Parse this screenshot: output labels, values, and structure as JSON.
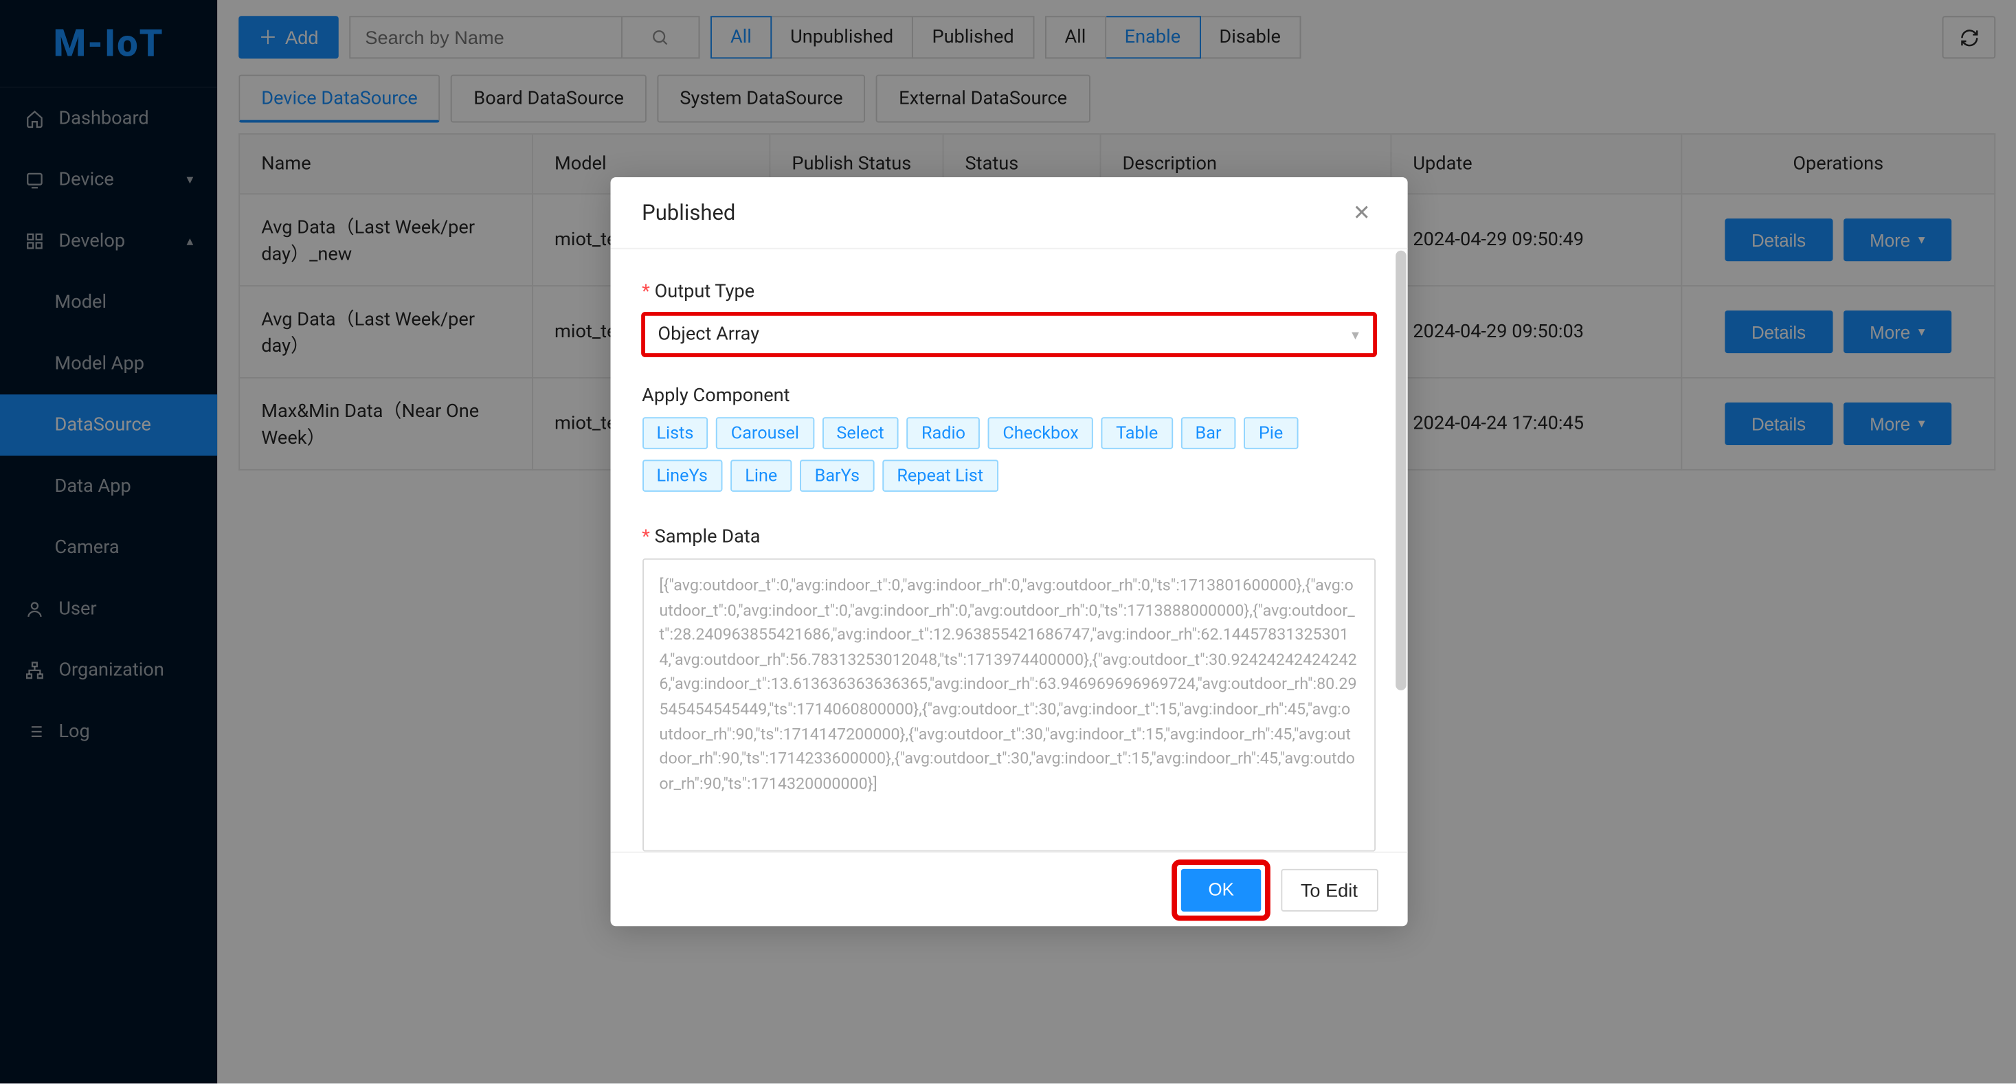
{
  "brand": "M-IoT",
  "sidebar": {
    "items": [
      {
        "icon": "home",
        "label": "Dashboard"
      },
      {
        "icon": "device",
        "label": "Device",
        "expandable": true
      },
      {
        "icon": "develop",
        "label": "Develop",
        "expandable": true,
        "open": true
      },
      {
        "icon": "",
        "label": "Model",
        "sub": true
      },
      {
        "icon": "",
        "label": "Model App",
        "sub": true
      },
      {
        "icon": "",
        "label": "DataSource",
        "sub": true,
        "active": true
      },
      {
        "icon": "",
        "label": "Data App",
        "sub": true
      },
      {
        "icon": "",
        "label": "Camera",
        "sub": true
      },
      {
        "icon": "user",
        "label": "User"
      },
      {
        "icon": "org",
        "label": "Organization"
      },
      {
        "icon": "log",
        "label": "Log"
      }
    ]
  },
  "toolbar": {
    "add_label": "Add",
    "search_placeholder": "Search by Name",
    "publish_filters": [
      "All",
      "Unpublished",
      "Published"
    ],
    "status_filters": [
      "All",
      "Enable",
      "Disable"
    ],
    "publish_active": 0,
    "status_active": 1
  },
  "tabs": [
    "Device DataSource",
    "Board DataSource",
    "System DataSource",
    "External DataSource"
  ],
  "tabs_active": 0,
  "table": {
    "columns": [
      "Name",
      "Model",
      "Publish Status",
      "Status",
      "Description",
      "Update",
      "Operations"
    ],
    "details_label": "Details",
    "more_label": "More",
    "rows": [
      {
        "name": "Avg Data（Last Week/per day）_new",
        "model": "miot_te",
        "update": "2024-04-29 09:50:49"
      },
      {
        "name": "Avg Data（Last Week/per day）",
        "model": "miot_te",
        "update": "2024-04-29 09:50:03"
      },
      {
        "name": "Max&Min Data（Near One Week）",
        "model": "miot_te",
        "update": "2024-04-24 17:40:45"
      }
    ]
  },
  "modal": {
    "title": "Published",
    "output_type_label": "Output Type",
    "output_type_value": "Object Array",
    "apply_component_label": "Apply Component",
    "components": [
      "Lists",
      "Carousel",
      "Select",
      "Radio",
      "Checkbox",
      "Table",
      "Bar",
      "Pie",
      "LineYs",
      "Line",
      "BarYs",
      "Repeat List"
    ],
    "sample_data_label": "Sample Data",
    "sample_data": "[{\"avg:outdoor_t\":0,\"avg:indoor_t\":0,\"avg:indoor_rh\":0,\"avg:outdoor_rh\":0,\"ts\":1713801600000},{\"avg:outdoor_t\":0,\"avg:indoor_t\":0,\"avg:indoor_rh\":0,\"avg:outdoor_rh\":0,\"ts\":1713888000000},{\"avg:outdoor_t\":28.240963855421686,\"avg:indoor_t\":12.963855421686747,\"avg:indoor_rh\":62.144578313253014,\"avg:outdoor_rh\":56.78313253012048,\"ts\":1713974400000},{\"avg:outdoor_t\":30.924242424242426,\"avg:indoor_t\":13.613636363636365,\"avg:indoor_rh\":63.946969696969724,\"avg:outdoor_rh\":80.29545454545449,\"ts\":1714060800000},{\"avg:outdoor_t\":30,\"avg:indoor_t\":15,\"avg:indoor_rh\":45,\"avg:outdoor_rh\":90,\"ts\":1714147200000},{\"avg:outdoor_t\":30,\"avg:indoor_t\":15,\"avg:indoor_rh\":45,\"avg:outdoor_rh\":90,\"ts\":1714233600000},{\"avg:outdoor_t\":30,\"avg:indoor_t\":15,\"avg:indoor_rh\":45,\"avg:outdoor_rh\":90,\"ts\":1714320000000}]",
    "ok_label": "OK",
    "to_edit_label": "To Edit"
  }
}
